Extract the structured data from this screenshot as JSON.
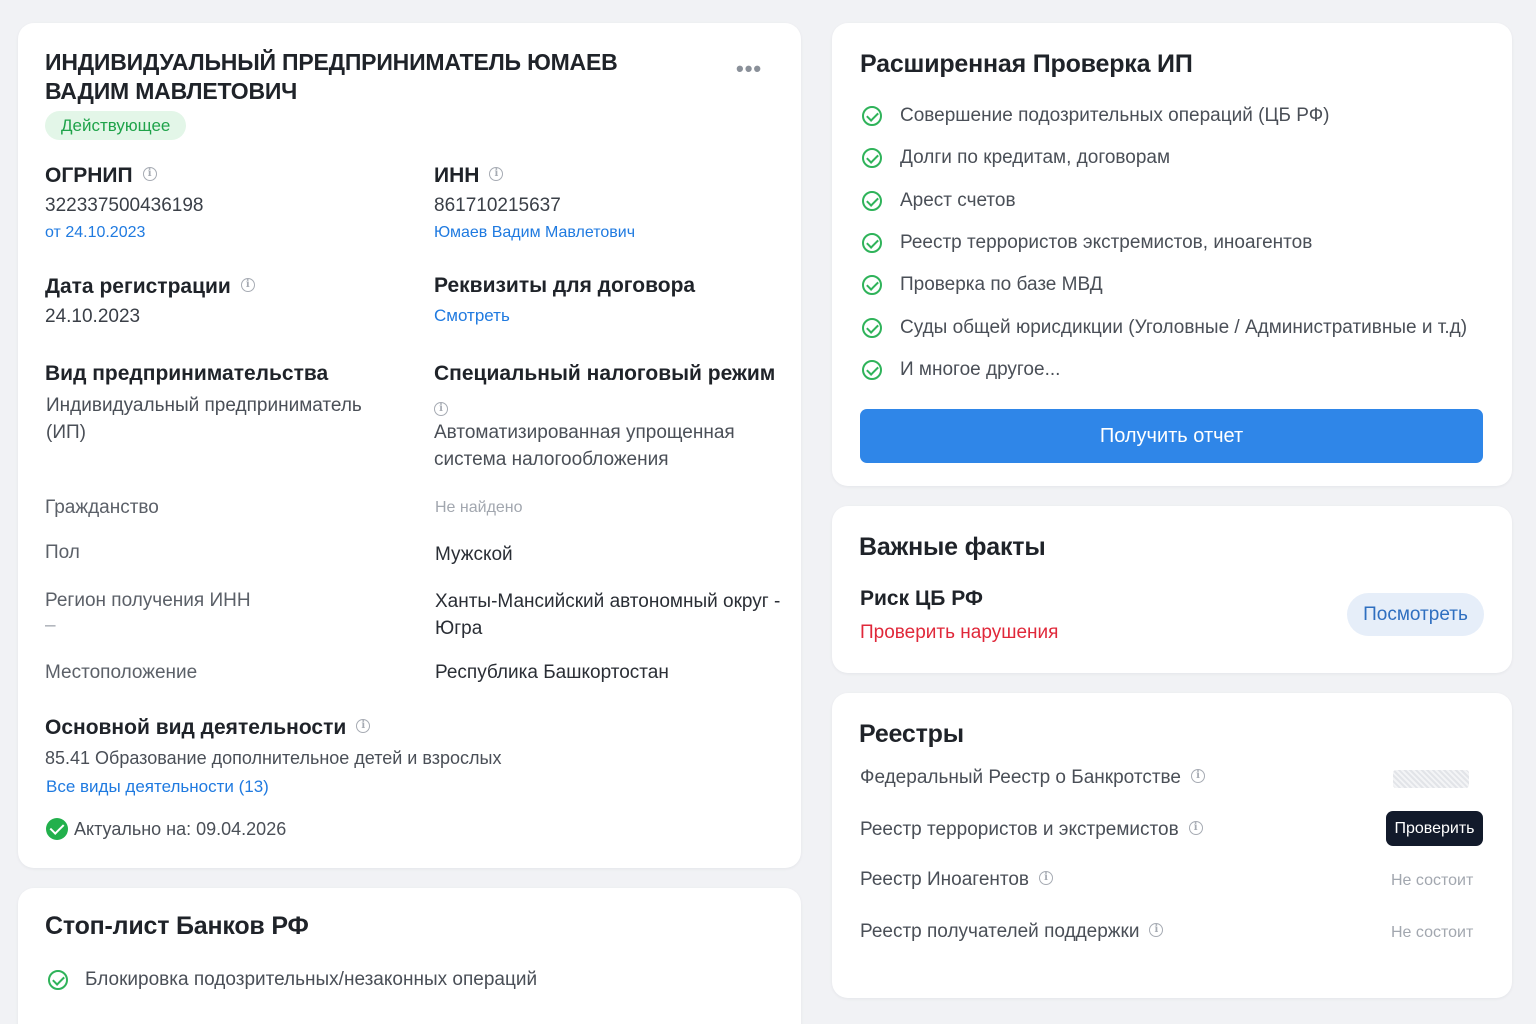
{
  "main": {
    "company_name": "Индивидуальный предприниматель Юмаев Вадим Мавлетович",
    "status": "Действующее",
    "ogrnip": {
      "label": "ОГРНИП",
      "value": "322337500436198",
      "date": "от 24.10.2023"
    },
    "inn": {
      "label": "ИНН",
      "value": "861710215637",
      "owner": "Юмаев Вадим Мавлетович"
    },
    "registration": {
      "label": "Дата регистрации",
      "value": "24.10.2023"
    },
    "requisites": {
      "label": "Реквизиты для договора",
      "link": "Смотреть"
    },
    "business_type": {
      "label": "Вид предпринимательства",
      "value_line1": "Индивидуальный предприниматель",
      "value_line2": "(ИП)"
    },
    "tax_regime": {
      "label": "Специальный налоговый режим",
      "value_line1": "Автоматизированная упрощенная",
      "value_line2": "система налогообложения"
    },
    "details": [
      {
        "label": "Гражданство",
        "value": "Не найдено"
      },
      {
        "label": "Пол",
        "value": "Мужской"
      },
      {
        "label": "Регион получения ИНН",
        "sub": "–",
        "value_line1": "Ханты-Мансийский автономный округ -",
        "value_line2": "Югра"
      },
      {
        "label": "Местоположение",
        "value": "Республика Башкортостан"
      }
    ],
    "activity": {
      "label": "Основной вид деятельности",
      "value": "85.41 Образование дополнительное детей и взрослых",
      "link": "Все виды деятельности (13)"
    },
    "actual": "Актуально на: 09.04.2026"
  },
  "stop_list": {
    "title": "Стоп-лист Банков РФ",
    "items": [
      "Блокировка подозрительных/незаконных операций"
    ]
  },
  "extended_check": {
    "title": "Расширенная Проверка ИП",
    "items": [
      "Совершение подозрительных операций (ЦБ РФ)",
      "Долги по кредитам, договорам",
      "Арест счетов",
      "Реестр террористов экстремистов, иноагентов",
      "Проверка по базе МВД",
      "Суды общей юрисдикции  (Уголовные / Административные и т.д)",
      "И многое другое..."
    ],
    "button": "Получить отчет"
  },
  "facts": {
    "title": "Важные факты",
    "risk_label": "Риск ЦБ РФ",
    "risk_link": "Проверить нарушения",
    "button": "Посмотреть"
  },
  "registries": {
    "title": "Реестры",
    "rows": [
      {
        "label": "Федеральный Реестр о Банкротстве"
      },
      {
        "label": "Реестр террористов и экстремистов",
        "button": "Проверить"
      },
      {
        "label": "Реестр Иноагентов",
        "status": "Не состоит"
      },
      {
        "label": "Реестр получателей поддержки",
        "status": "Не состоит"
      }
    ]
  },
  "colors": {
    "accent": "#2f86e8",
    "success": "#22b04c",
    "danger": "#e0283a",
    "link": "#1f7ae0"
  }
}
